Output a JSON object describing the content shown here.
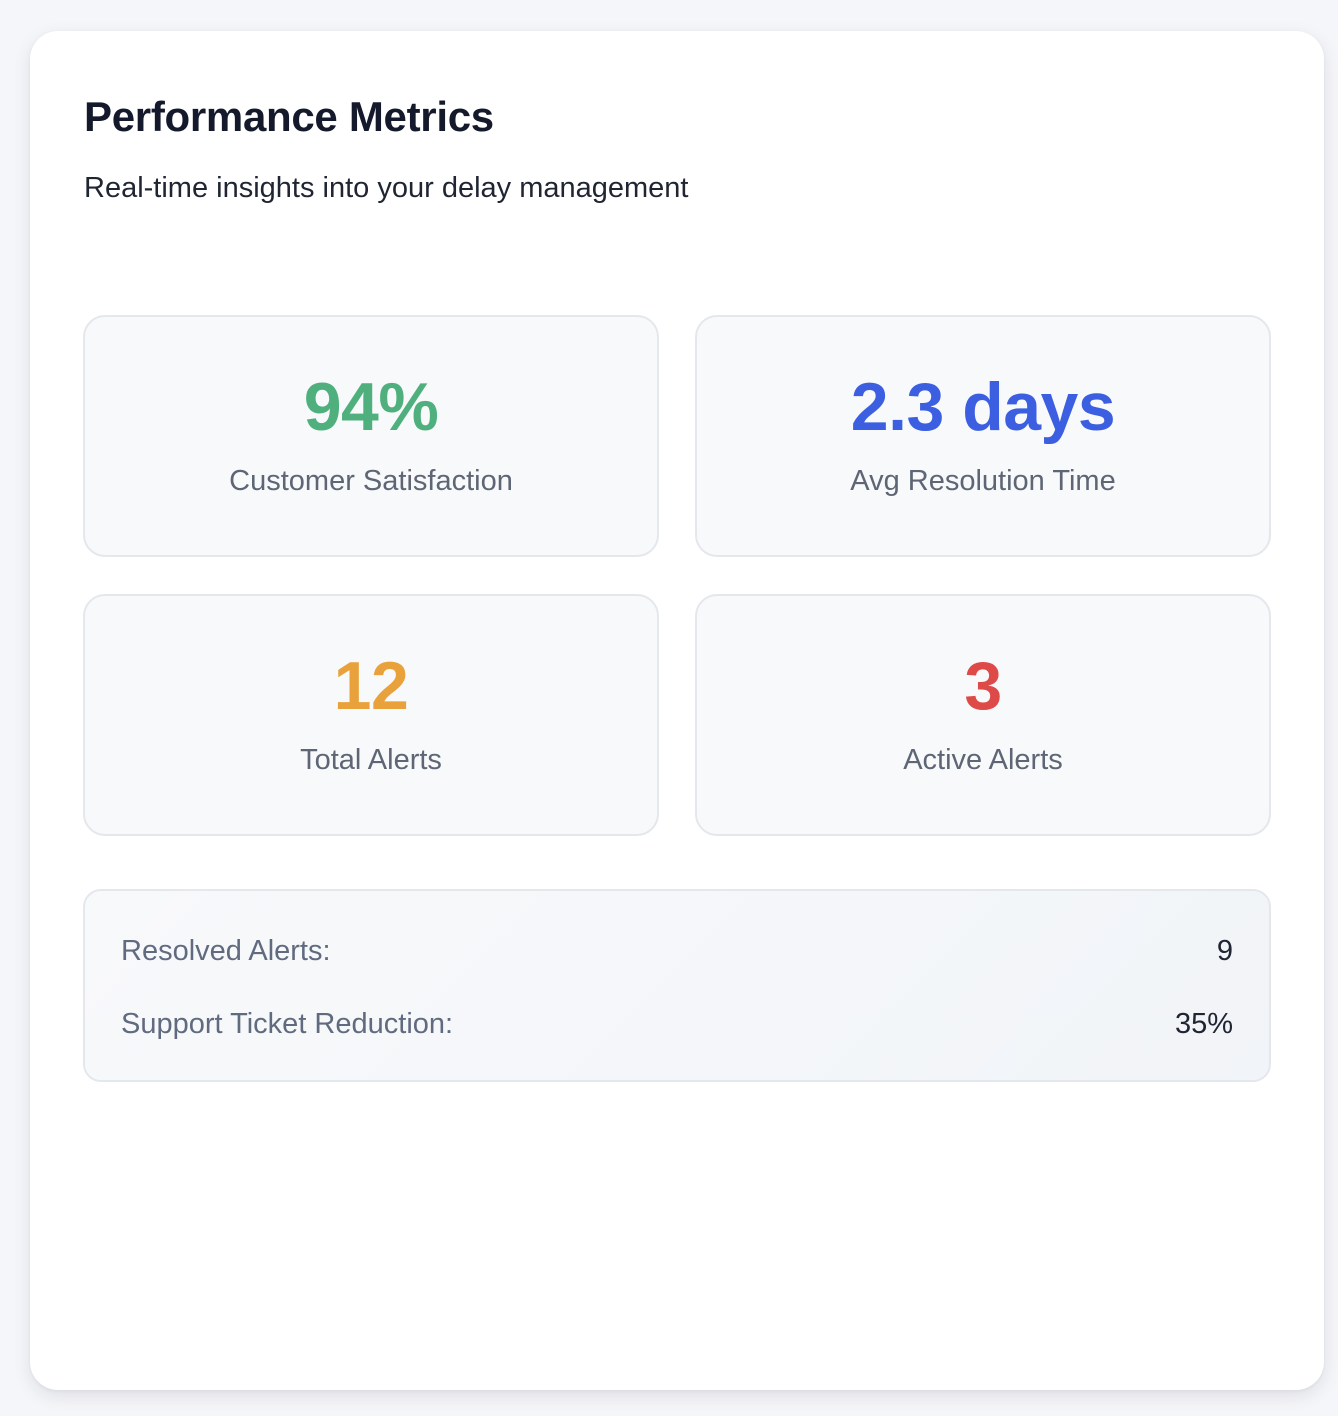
{
  "header": {
    "title": "Performance Metrics",
    "subtitle": "Real-time insights into your delay management"
  },
  "metrics": [
    {
      "value": "94%",
      "label": "Customer Satisfaction",
      "color": "#4fb07d"
    },
    {
      "value": "2.3 days",
      "label": "Avg Resolution Time",
      "color": "#3b5fe0"
    },
    {
      "value": "12",
      "label": "Total Alerts",
      "color": "#e9a23b"
    },
    {
      "value": "3",
      "label": "Active Alerts",
      "color": "#de4a48"
    }
  ],
  "summary": {
    "rows": [
      {
        "label": "Resolved Alerts:",
        "value": "9"
      },
      {
        "label": "Support Ticket Reduction:",
        "value": "35%"
      }
    ]
  }
}
